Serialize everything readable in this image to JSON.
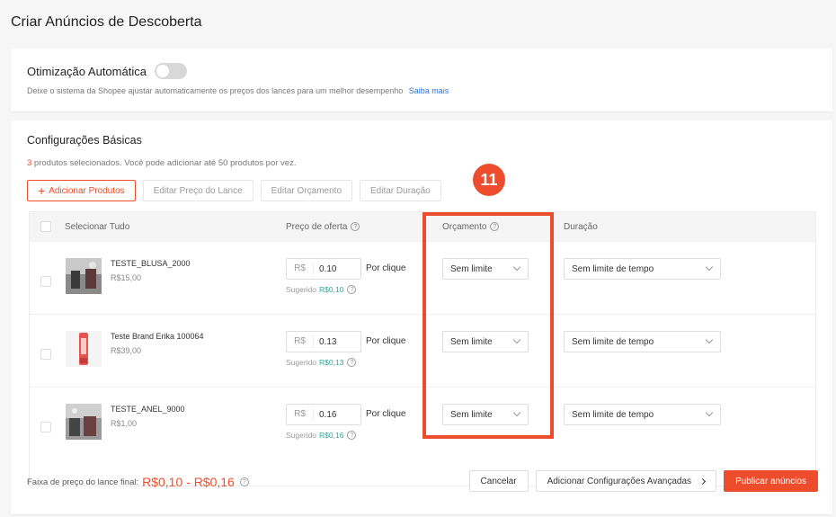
{
  "page": {
    "title": "Criar Anúncios de Descoberta"
  },
  "auto_optimization": {
    "title": "Otimização Automática",
    "description": "Deixe o sistema da Shopee ajustar automaticamente os preços dos lances para um melhor desempenho",
    "learn_more": "Saiba mais",
    "enabled": false
  },
  "basic": {
    "title": "Configurações Básicas",
    "selected_count": "3",
    "selected_text": " produtos selecionados. Você pode adicionar até 50 produtos por vez.",
    "buttons": {
      "add_products": "Adicionar Produtos",
      "edit_bid": "Editar Preço do Lance",
      "edit_budget": "Editar Orçamento",
      "edit_duration": "Editar Duração"
    },
    "step_badge": "11",
    "table": {
      "headers": {
        "select_all": "Selecionar Tudo",
        "offer_price": "Preço de oferta",
        "budget": "Orçamento",
        "duration": "Duração"
      },
      "rows": [
        {
          "name": "TESTE_BLUSA_2000",
          "price": "R$15,00",
          "currency": "R$",
          "bid": "0.10",
          "per_click": "Por clique",
          "suggested_label": "Sugerido",
          "suggested": "R$0,10",
          "budget": "Sem limite",
          "duration": "Sem limite de tempo"
        },
        {
          "name": "Teste Brand Erika 100064",
          "price": "R$39,00",
          "currency": "R$",
          "bid": "0.13",
          "per_click": "Por clique",
          "suggested_label": "Sugerido",
          "suggested": "R$0,13",
          "budget": "Sem limite",
          "duration": "Sem limite de tempo"
        },
        {
          "name": "TESTE_ANEL_9000",
          "price": "R$1,00",
          "currency": "R$",
          "bid": "0.16",
          "per_click": "Por clique",
          "suggested_label": "Sugerido",
          "suggested": "R$0,16",
          "budget": "Sem limite",
          "duration": "Sem limite de tempo"
        }
      ]
    },
    "footer": {
      "range_label": "Faixa de preço do lance final:",
      "range_value": "R$0,10 - R$0,16",
      "cancel": "Cancelar",
      "advanced": "Adicionar Configurações Avançadas",
      "publish": "Publicar anúncios"
    }
  },
  "colors": {
    "accent": "#ee4d2d",
    "suggested": "#26aa99",
    "link": "#2673dd"
  },
  "icons": [
    "help-icon",
    "plus-icon",
    "chevron-down-icon",
    "chevron-right-icon"
  ]
}
